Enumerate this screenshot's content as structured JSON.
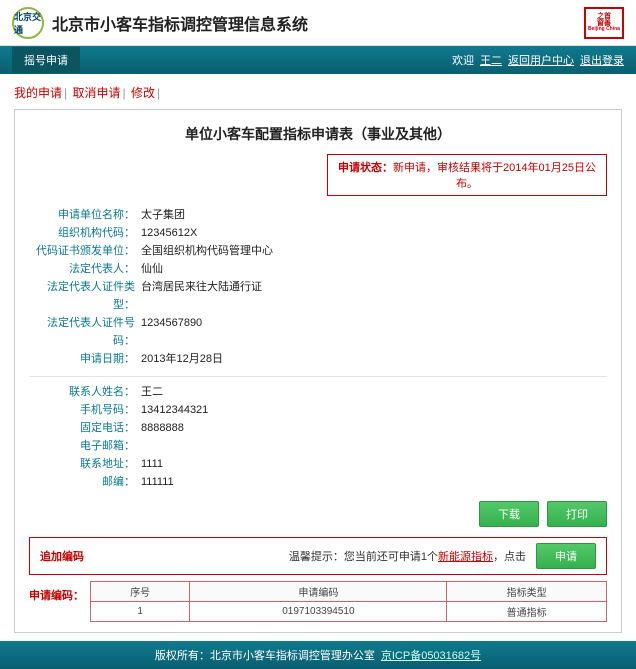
{
  "header": {
    "logo_text": "北京交通",
    "title": "北京市小客车指标调控管理信息系统",
    "stamp_top": "之首",
    "stamp_bottom": "窗善",
    "stamp_en": "Beijing China"
  },
  "nav": {
    "tab": "摇号申请",
    "welcome": "欢迎",
    "user": "王二",
    "back": "返回用户中心",
    "logout": "退出登录"
  },
  "breadcrumb": {
    "a": "我的申请",
    "b": "取消申请",
    "c": "修改"
  },
  "form": {
    "title": "单位小客车配置指标申请表（事业及其他）",
    "status_label": "申请状态：",
    "status_value": "新申请，审核结果将于2014年01月25日公布。",
    "rows1": [
      {
        "k": "申请单位名称：",
        "v": "太子集团"
      },
      {
        "k": "组织机构代码：",
        "v": "12345612X"
      },
      {
        "k": "代码证书颁发单位：",
        "v": "全国组织机构代码管理中心"
      },
      {
        "k": "法定代表人：",
        "v": "仙仙"
      },
      {
        "k": "法定代表人证件类型：",
        "v": "台湾居民来往大陆通行证"
      },
      {
        "k": "法定代表人证件号码：",
        "v": "1234567890"
      },
      {
        "k": "申请日期：",
        "v": "2013年12月28日"
      }
    ],
    "rows2": [
      {
        "k": "联系人姓名：",
        "v": "王二"
      },
      {
        "k": "手机号码：",
        "v": "13412344321"
      },
      {
        "k": "固定电话：",
        "v": "8888888"
      },
      {
        "k": "电子邮箱：",
        "v": ""
      },
      {
        "k": "联系地址：",
        "v": "1111"
      },
      {
        "k": "邮编：",
        "v": "111111"
      }
    ],
    "btn_download": "下载",
    "btn_print": "打印",
    "add_label": "追加编码",
    "add_tip_pre": "温馨提示：您当前还可申请1个",
    "add_tip_hl": "新能源指标",
    "add_tip_post": "，点击",
    "btn_apply": "申请",
    "appnum_label": "申请编码：",
    "table": {
      "headers": [
        "序号",
        "申请编码",
        "指标类型"
      ],
      "rows": [
        [
          "1",
          "0197103394510",
          "普通指标"
        ]
      ]
    }
  },
  "footer": {
    "owner": "版权所有：北京市小客车指标调控管理办公室",
    "icp": "京ICP备05031682号"
  }
}
